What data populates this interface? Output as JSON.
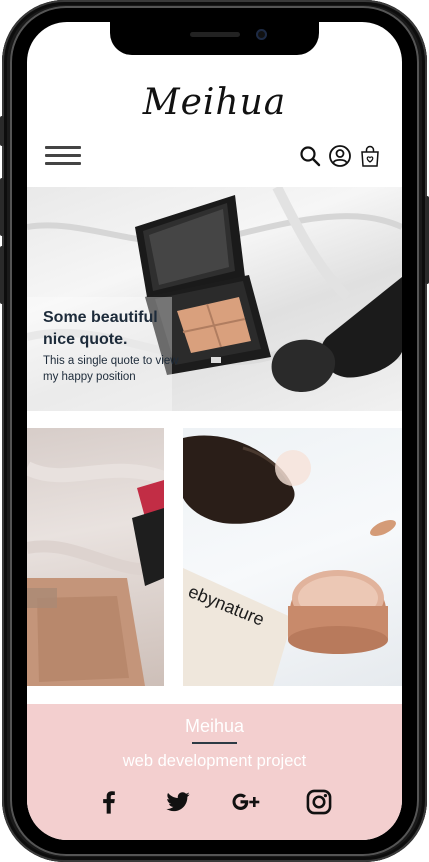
{
  "header": {
    "logo": "Meihua",
    "icons": [
      "menu-icon",
      "search-icon",
      "user-icon",
      "shopping-bag-icon"
    ]
  },
  "hero": {
    "title_line1": "Some beautiful",
    "title_line2": "nice quote.",
    "subtitle": "This a single quote to view my happy position"
  },
  "products": [
    {
      "image": "perfume-lipstick-photo"
    },
    {
      "image": "brush-cream-photo",
      "brand_text": "ebynature"
    }
  ],
  "footer": {
    "brand": "Meihua",
    "tagline": "web development project",
    "social": [
      "facebook-icon",
      "twitter-icon",
      "google-plus-icon",
      "instagram-icon"
    ],
    "bg_color": "#f3cfcf"
  }
}
